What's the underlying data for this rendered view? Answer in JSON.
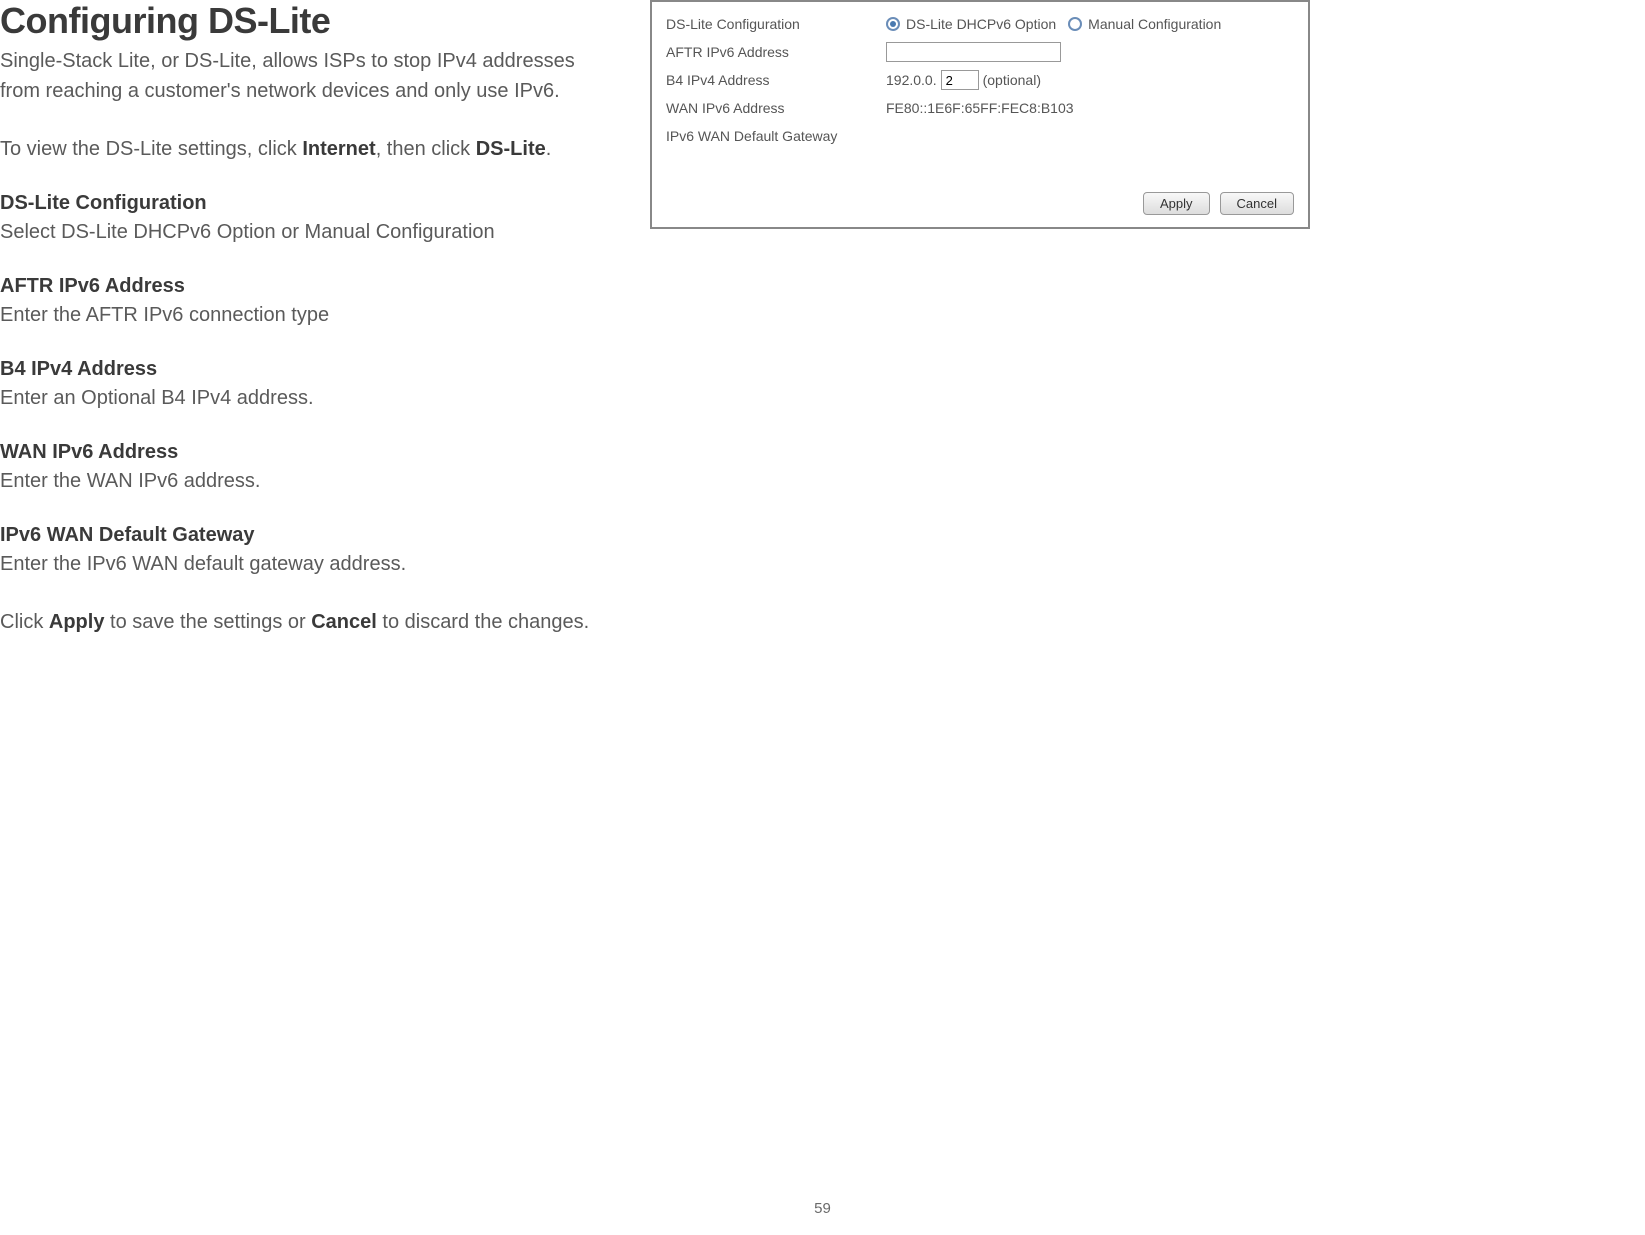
{
  "doc": {
    "title": "Configuring DS-Lite",
    "intro": "Single-Stack Lite, or DS-Lite, allows ISPs to stop IPv4 addresses from reaching a customer's network devices and only use IPv6.",
    "nav_prefix": "To view the DS-Lite settings, click ",
    "nav_bold1": "Internet",
    "nav_mid": ", then click ",
    "nav_bold2": "DS-Lite",
    "nav_suffix": ".",
    "sections": {
      "cfg": {
        "title": "DS-Lite Configuration",
        "desc": "Select DS-Lite DHCPv6 Option or Manual Configuration"
      },
      "aftr": {
        "title": "AFTR IPv6 Address",
        "desc": "Enter the AFTR IPv6 connection type"
      },
      "b4": {
        "title": "B4 IPv4 Address",
        "desc": "Enter an Optional B4 IPv4 address."
      },
      "wan": {
        "title": "WAN IPv6 Address",
        "desc": "Enter the WAN IPv6 address."
      },
      "gw": {
        "title": "IPv6 WAN Default Gateway",
        "desc": "Enter the IPv6 WAN default gateway address."
      }
    },
    "footer_prefix": "Click ",
    "footer_bold1": "Apply",
    "footer_mid": " to save the settings or ",
    "footer_bold2": "Cancel",
    "footer_suffix": " to discard the changes.",
    "page_number": "59"
  },
  "panel": {
    "labels": {
      "config": "DS-Lite Configuration",
      "aftr": "AFTR IPv6 Address",
      "b4": "B4 IPv4 Address",
      "wan": "WAN IPv6 Address",
      "gw": "IPv6 WAN Default Gateway"
    },
    "radio1": "DS-Lite DHCPv6 Option",
    "radio2": "Manual Configuration",
    "b4_prefix": "192.0.0.",
    "b4_octet": "2",
    "b4_suffix": "(optional)",
    "wan_value": "FE80::1E6F:65FF:FEC8:B103",
    "apply": "Apply",
    "cancel": "Cancel"
  }
}
